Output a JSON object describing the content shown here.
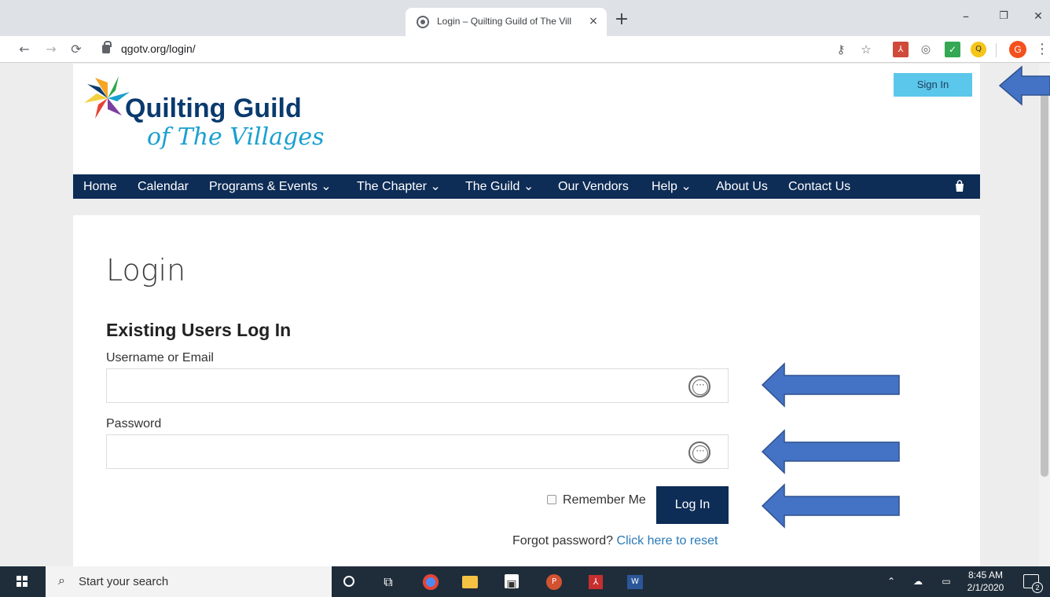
{
  "browser": {
    "tab_title": "Login – Quilting Guild of The Vill",
    "tab_close": "×",
    "new_tab": "+",
    "url": "qgotv.org/login/",
    "window_controls": {
      "minimize": "–",
      "maximize": "❐",
      "close": "✕"
    },
    "profile_initial": "G"
  },
  "site": {
    "logo_text_main": "Quilting Guild",
    "logo_text_sub": "of The Villages",
    "sign_in_label": "Sign In",
    "nav": [
      {
        "label": "Home"
      },
      {
        "label": "Calendar"
      },
      {
        "label": "Programs & Events",
        "dropdown": "⌄"
      },
      {
        "label": "The Chapter",
        "dropdown": "⌄"
      },
      {
        "label": "The Guild",
        "dropdown": "⌄"
      },
      {
        "label": "Our Vendors"
      },
      {
        "label": "Help",
        "dropdown": "⌄"
      },
      {
        "label": "About Us"
      },
      {
        "label": "Contact Us"
      }
    ]
  },
  "login": {
    "page_title": "Login",
    "section_title": "Existing Users Log In",
    "username_label": "Username or Email",
    "username_value": "",
    "password_label": "Password",
    "password_value": "",
    "remember_label": "Remember Me",
    "remember_checked": false,
    "submit_label": "Log In",
    "forgot_text": "Forgot password?",
    "forgot_link": "Click here to reset"
  },
  "annotations": {
    "arrow_color": "#4472c4",
    "arrow_border": "#2f528f"
  },
  "taskbar": {
    "search_placeholder": "Start your search",
    "time": "8:45 AM",
    "date": "2/1/2020",
    "notification_count": "2",
    "apps": [
      "cortana-icon",
      "task-view-icon",
      "chrome-icon",
      "file-explorer-icon",
      "store-icon",
      "powerpoint-icon",
      "acrobat-icon",
      "word-icon"
    ]
  },
  "colors": {
    "nav_bg": "#0d2c56",
    "sign_in_bg": "#5bc7ea",
    "link": "#2a7ab8",
    "login_btn": "#0d2c56"
  }
}
